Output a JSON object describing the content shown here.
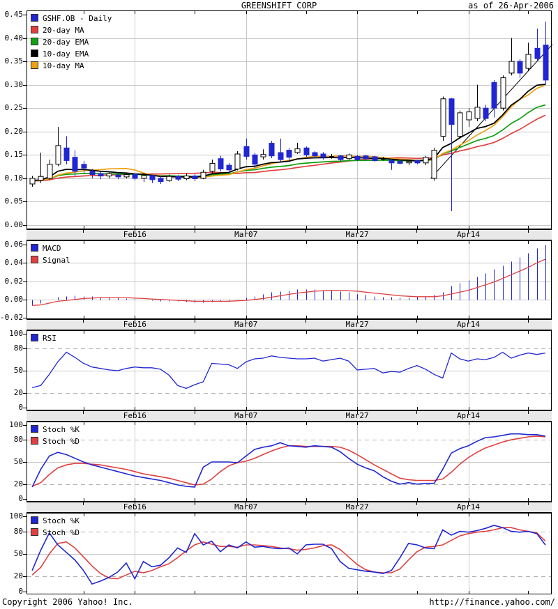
{
  "header": {
    "title": "GREENSHIFT CORP",
    "as_of": "as of 26-Apr-2006"
  },
  "footer": {
    "copyright": "Copyright 2006 Yahoo! Inc.",
    "url": "http://finance.yahoo.com/"
  },
  "colors": {
    "blue": "#2026d2",
    "red": "#e04040",
    "green": "#10a010",
    "orange": "#f0a010",
    "black": "#000000",
    "grid": "#c8c8c8",
    "grid_dashed": "#b2b2b2",
    "band_bg": "#e8e8e8",
    "background": "#ffffff"
  },
  "x_axis": {
    "labels": [
      "Feb16",
      "Mar07",
      "Mar27",
      "Apr14"
    ],
    "label_indices": [
      12,
      25,
      38,
      51
    ],
    "tick_indices": [
      6,
      12,
      19,
      25,
      32,
      38,
      45,
      51,
      58
    ]
  },
  "chart_data": [
    {
      "type": "candlestick",
      "title": "GREENSHIFT CORP",
      "legend": [
        {
          "label": "GSHF.OB - Daily",
          "color": "#2026d2"
        },
        {
          "label": "20-day MA",
          "color": "#e04040"
        },
        {
          "label": "20-day EMA",
          "color": "#10a010"
        },
        {
          "label": "10-day EMA",
          "color": "#000000"
        },
        {
          "label": "10-day MA",
          "color": "#f0a010"
        }
      ],
      "ylim": [
        0,
        0.45
      ],
      "y_tick_labels": [
        "0.45",
        "0.40",
        "0.35",
        "0.30",
        "0.25",
        "0.20",
        "0.15",
        "0.10",
        "0.05",
        "0.00"
      ],
      "y_tick_values": [
        0.45,
        0.4,
        0.35,
        0.3,
        0.25,
        0.2,
        0.15,
        0.1,
        0.05,
        0.0
      ],
      "y_gridline_values": [
        0.0,
        0.05,
        0.1,
        0.15,
        0.2,
        0.25,
        0.3,
        0.35,
        0.4
      ],
      "prehistory_close": 0.094,
      "overlays": [
        "20-day MA",
        "20-day EMA",
        "10-day EMA",
        "10-day MA",
        "trendline"
      ],
      "trendline": {
        "i1": 46.6,
        "v1": 0.1,
        "i2": 61.5,
        "v2": 0.4
      },
      "ohlc": [
        [
          0.088,
          0.105,
          0.082,
          0.1
        ],
        [
          0.096,
          0.155,
          0.09,
          0.104
        ],
        [
          0.1,
          0.14,
          0.097,
          0.13
        ],
        [
          0.13,
          0.21,
          0.126,
          0.17
        ],
        [
          0.165,
          0.19,
          0.13,
          0.138
        ],
        [
          0.145,
          0.16,
          0.105,
          0.115
        ],
        [
          0.13,
          0.137,
          0.112,
          0.122
        ],
        [
          0.115,
          0.12,
          0.1,
          0.108
        ],
        [
          0.11,
          0.115,
          0.098,
          0.105
        ],
        [
          0.105,
          0.113,
          0.1,
          0.11
        ],
        [
          0.107,
          0.112,
          0.098,
          0.103
        ],
        [
          0.103,
          0.112,
          0.1,
          0.108
        ],
        [
          0.108,
          0.11,
          0.095,
          0.1
        ],
        [
          0.1,
          0.112,
          0.092,
          0.106
        ],
        [
          0.106,
          0.108,
          0.09,
          0.097
        ],
        [
          0.1,
          0.104,
          0.088,
          0.093
        ],
        [
          0.095,
          0.108,
          0.092,
          0.104
        ],
        [
          0.104,
          0.107,
          0.094,
          0.098
        ],
        [
          0.099,
          0.11,
          0.096,
          0.105
        ],
        [
          0.105,
          0.109,
          0.094,
          0.099
        ],
        [
          0.1,
          0.118,
          0.098,
          0.113
        ],
        [
          0.115,
          0.14,
          0.11,
          0.132
        ],
        [
          0.142,
          0.148,
          0.115,
          0.12
        ],
        [
          0.128,
          0.133,
          0.112,
          0.118
        ],
        [
          0.12,
          0.158,
          0.117,
          0.152
        ],
        [
          0.168,
          0.185,
          0.14,
          0.147
        ],
        [
          0.15,
          0.155,
          0.122,
          0.13
        ],
        [
          0.146,
          0.162,
          0.14,
          0.151
        ],
        [
          0.175,
          0.18,
          0.143,
          0.148
        ],
        [
          0.155,
          0.185,
          0.136,
          0.14
        ],
        [
          0.16,
          0.165,
          0.14,
          0.145
        ],
        [
          0.155,
          0.176,
          0.152,
          0.163
        ],
        [
          0.165,
          0.168,
          0.146,
          0.15
        ],
        [
          0.155,
          0.158,
          0.144,
          0.148
        ],
        [
          0.152,
          0.156,
          0.14,
          0.145
        ],
        [
          0.147,
          0.152,
          0.142,
          0.147
        ],
        [
          0.148,
          0.15,
          0.137,
          0.14
        ],
        [
          0.142,
          0.153,
          0.139,
          0.15
        ],
        [
          0.147,
          0.15,
          0.137,
          0.14
        ],
        [
          0.148,
          0.15,
          0.138,
          0.142
        ],
        [
          0.146,
          0.148,
          0.135,
          0.138
        ],
        [
          0.142,
          0.146,
          0.138,
          0.142
        ],
        [
          0.138,
          0.142,
          0.118,
          0.133
        ],
        [
          0.136,
          0.14,
          0.13,
          0.132
        ],
        [
          0.133,
          0.138,
          0.128,
          0.136
        ],
        [
          0.138,
          0.14,
          0.13,
          0.133
        ],
        [
          0.133,
          0.148,
          0.128,
          0.145
        ],
        [
          0.1,
          0.165,
          0.095,
          0.16
        ],
        [
          0.19,
          0.275,
          0.18,
          0.27
        ],
        [
          0.27,
          0.272,
          0.03,
          0.215
        ],
        [
          0.19,
          0.245,
          0.185,
          0.24
        ],
        [
          0.225,
          0.25,
          0.21,
          0.242
        ],
        [
          0.228,
          0.3,
          0.222,
          0.252
        ],
        [
          0.25,
          0.257,
          0.222,
          0.228
        ],
        [
          0.305,
          0.31,
          0.23,
          0.25
        ],
        [
          0.25,
          0.32,
          0.245,
          0.315
        ],
        [
          0.325,
          0.4,
          0.32,
          0.35
        ],
        [
          0.35,
          0.355,
          0.315,
          0.325
        ],
        [
          0.335,
          0.39,
          0.33,
          0.365
        ],
        [
          0.378,
          0.42,
          0.35,
          0.356
        ],
        [
          0.385,
          0.435,
          0.3,
          0.31
        ]
      ]
    },
    {
      "type": "bar",
      "legend": [
        {
          "label": "MACD",
          "color": "#2026d2"
        },
        {
          "label": "Signal",
          "color": "#e04040"
        }
      ],
      "ylim": [
        -0.02,
        0.065
      ],
      "y_tick_labels": [
        "0.06",
        "0.04",
        "0.02",
        "0.00",
        "-0.02"
      ],
      "y_tick_values": [
        0.06,
        0.04,
        0.02,
        0.0,
        -0.02
      ],
      "y_gridlines_solid": [
        0.04,
        0.02,
        0.0
      ],
      "macd": [
        -0.006,
        -0.004,
        0.0,
        0.003,
        0.004,
        0.0045,
        0.004,
        0.0035,
        0.003,
        0.0025,
        0.002,
        0.001,
        0.0005,
        0.0,
        -0.001,
        -0.0015,
        -0.002,
        -0.002,
        -0.0025,
        -0.003,
        -0.003,
        -0.0025,
        -0.002,
        -0.0015,
        0.0,
        0.002,
        0.004,
        0.006,
        0.008,
        0.009,
        0.01,
        0.011,
        0.0115,
        0.011,
        0.0105,
        0.01,
        0.009,
        0.008,
        0.006,
        0.005,
        0.004,
        0.003,
        0.0025,
        0.002,
        0.002,
        0.0025,
        0.003,
        0.005,
        0.008,
        0.015,
        0.018,
        0.021,
        0.025,
        0.029,
        0.033,
        0.037,
        0.042,
        0.046,
        0.051,
        0.056,
        0.06
      ],
      "signal": [
        -0.0065,
        -0.006,
        -0.004,
        -0.002,
        -0.001,
        0.0,
        0.001,
        0.0015,
        0.002,
        0.002,
        0.002,
        0.002,
        0.0015,
        0.001,
        0.0005,
        0.0,
        -0.0005,
        -0.001,
        -0.0015,
        -0.002,
        -0.002,
        -0.002,
        -0.002,
        -0.002,
        -0.0015,
        -0.001,
        0.0,
        0.001,
        0.0025,
        0.004,
        0.0055,
        0.007,
        0.008,
        0.009,
        0.0095,
        0.01,
        0.01,
        0.0095,
        0.009,
        0.008,
        0.007,
        0.006,
        0.005,
        0.004,
        0.0035,
        0.003,
        0.003,
        0.003,
        0.004,
        0.006,
        0.008,
        0.01,
        0.013,
        0.016,
        0.019,
        0.023,
        0.027,
        0.031,
        0.035,
        0.04,
        0.044
      ]
    },
    {
      "type": "line",
      "legend": [
        {
          "label": "RSI",
          "color": "#2026d2"
        }
      ],
      "ylim": [
        0,
        100
      ],
      "y_tick_labels": [
        "100",
        "80",
        "50",
        "20",
        "0"
      ],
      "y_tick_values": [
        100,
        80,
        50,
        20,
        0
      ],
      "y_gridlines_dashed": [
        80,
        20
      ],
      "y_gridlines_solid": [
        50
      ],
      "values": [
        27,
        30,
        45,
        62,
        75,
        68,
        60,
        55,
        53,
        51,
        50,
        53,
        55,
        54,
        54,
        52,
        44,
        30,
        26,
        31,
        35,
        60,
        59,
        58,
        53,
        62,
        66,
        67,
        70,
        68,
        67,
        66,
        66,
        67,
        63,
        65,
        67,
        63,
        51,
        52,
        53,
        47,
        49,
        48,
        53,
        57,
        52,
        45,
        40,
        74,
        66,
        63,
        66,
        65,
        68,
        75,
        67,
        71,
        74,
        72,
        74
      ]
    },
    {
      "type": "line",
      "legend": [
        {
          "label": "Stoch %K",
          "color": "#2026d2"
        },
        {
          "label": "Stoch %D",
          "color": "#e04040"
        }
      ],
      "ylim": [
        0,
        100
      ],
      "y_tick_labels": [
        "100",
        "80",
        "50",
        "20",
        "0"
      ],
      "y_tick_values": [
        100,
        80,
        50,
        20,
        0
      ],
      "y_gridlines_dashed": [
        80,
        20
      ],
      "y_gridlines_solid": [
        50
      ],
      "k": [
        16,
        40,
        58,
        63,
        60,
        55,
        50,
        46,
        43,
        40,
        37,
        34,
        31,
        29,
        27,
        25,
        22,
        19,
        17,
        16,
        43,
        50,
        50,
        50,
        49,
        58,
        67,
        70,
        72,
        76,
        72,
        71,
        70,
        72,
        71,
        70,
        64,
        55,
        47,
        42,
        38,
        30,
        24,
        20,
        22,
        20,
        21,
        21,
        40,
        62,
        68,
        72,
        78,
        83,
        84,
        86,
        88,
        88,
        87,
        87,
        85
      ],
      "d": [
        17,
        22,
        33,
        42,
        46,
        48,
        48,
        47,
        46,
        44,
        42,
        40,
        37,
        34,
        32,
        30,
        28,
        25,
        22,
        19,
        20,
        27,
        37,
        45,
        49,
        51,
        55,
        60,
        65,
        69,
        72,
        72,
        71,
        71,
        71,
        71,
        70,
        66,
        60,
        53,
        46,
        40,
        34,
        28,
        26,
        25,
        25,
        25,
        27,
        36,
        47,
        56,
        63,
        69,
        73,
        77,
        80,
        82,
        84,
        85,
        84
      ]
    },
    {
      "type": "line",
      "legend": [
        {
          "label": "Stoch %K",
          "color": "#2026d2"
        },
        {
          "label": "Stoch %D",
          "color": "#e04040"
        }
      ],
      "ylim": [
        0,
        100
      ],
      "y_tick_labels": [
        "100",
        "80",
        "50",
        "20",
        "0"
      ],
      "y_tick_values": [
        100,
        80,
        50,
        20,
        0
      ],
      "y_gridlines_dashed": [
        80,
        20
      ],
      "y_gridlines_solid": [
        50
      ],
      "k": [
        28,
        55,
        78,
        62,
        52,
        42,
        28,
        10,
        14,
        19,
        26,
        38,
        17,
        40,
        33,
        35,
        45,
        58,
        52,
        77,
        62,
        67,
        53,
        62,
        58,
        66,
        59,
        60,
        58,
        57,
        58,
        50,
        62,
        63,
        63,
        57,
        40,
        31,
        29,
        27,
        26,
        24,
        28,
        45,
        64,
        62,
        58,
        57,
        82,
        75,
        80,
        79,
        81,
        84,
        88,
        85,
        80,
        79,
        80,
        77,
        62
      ],
      "d": [
        22,
        32,
        50,
        64,
        66,
        58,
        46,
        34,
        24,
        18,
        17,
        22,
        27,
        25,
        28,
        33,
        37,
        45,
        54,
        62,
        66,
        63,
        60,
        60,
        59,
        62,
        62,
        61,
        60,
        58,
        57,
        55,
        56,
        58,
        61,
        62,
        56,
        46,
        36,
        29,
        26,
        25,
        25,
        30,
        42,
        53,
        59,
        60,
        62,
        68,
        74,
        77,
        79,
        80,
        82,
        85,
        85,
        82,
        80,
        78,
        67
      ]
    }
  ]
}
